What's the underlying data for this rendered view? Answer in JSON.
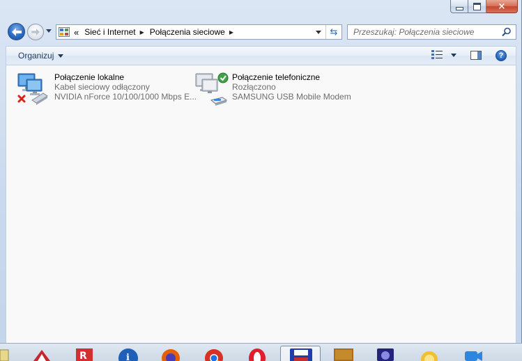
{
  "window": {
    "buttons": {
      "minimize": "minimize",
      "maximize": "maximize",
      "close": "×"
    }
  },
  "address_bar": {
    "overflow": "«",
    "crumbs": [
      "Sieć i Internet",
      "Połączenia sieciowe"
    ]
  },
  "search": {
    "placeholder": "Przeszukaj: Połączenia sieciowe"
  },
  "command_bar": {
    "organize_label": "Organizuj"
  },
  "connections": [
    {
      "name": "Połączenie lokalne",
      "status": "Kabel sieciowy odłączony",
      "device": "NVIDIA nForce 10/100/1000 Mbps E..."
    },
    {
      "name": "Połączenie telefoniczne",
      "status": "Rozłączono",
      "device": "SAMSUNG USB Mobile Modem"
    }
  ],
  "help_label": "?",
  "taskbar_icons": [
    "app-icon",
    "pdf-icon",
    "info-icon",
    "firefox-icon",
    "chrome-icon",
    "opera-icon",
    "floppy-save-icon",
    "box-icon",
    "media-icon",
    "sun-icon",
    "camera-icon"
  ]
}
